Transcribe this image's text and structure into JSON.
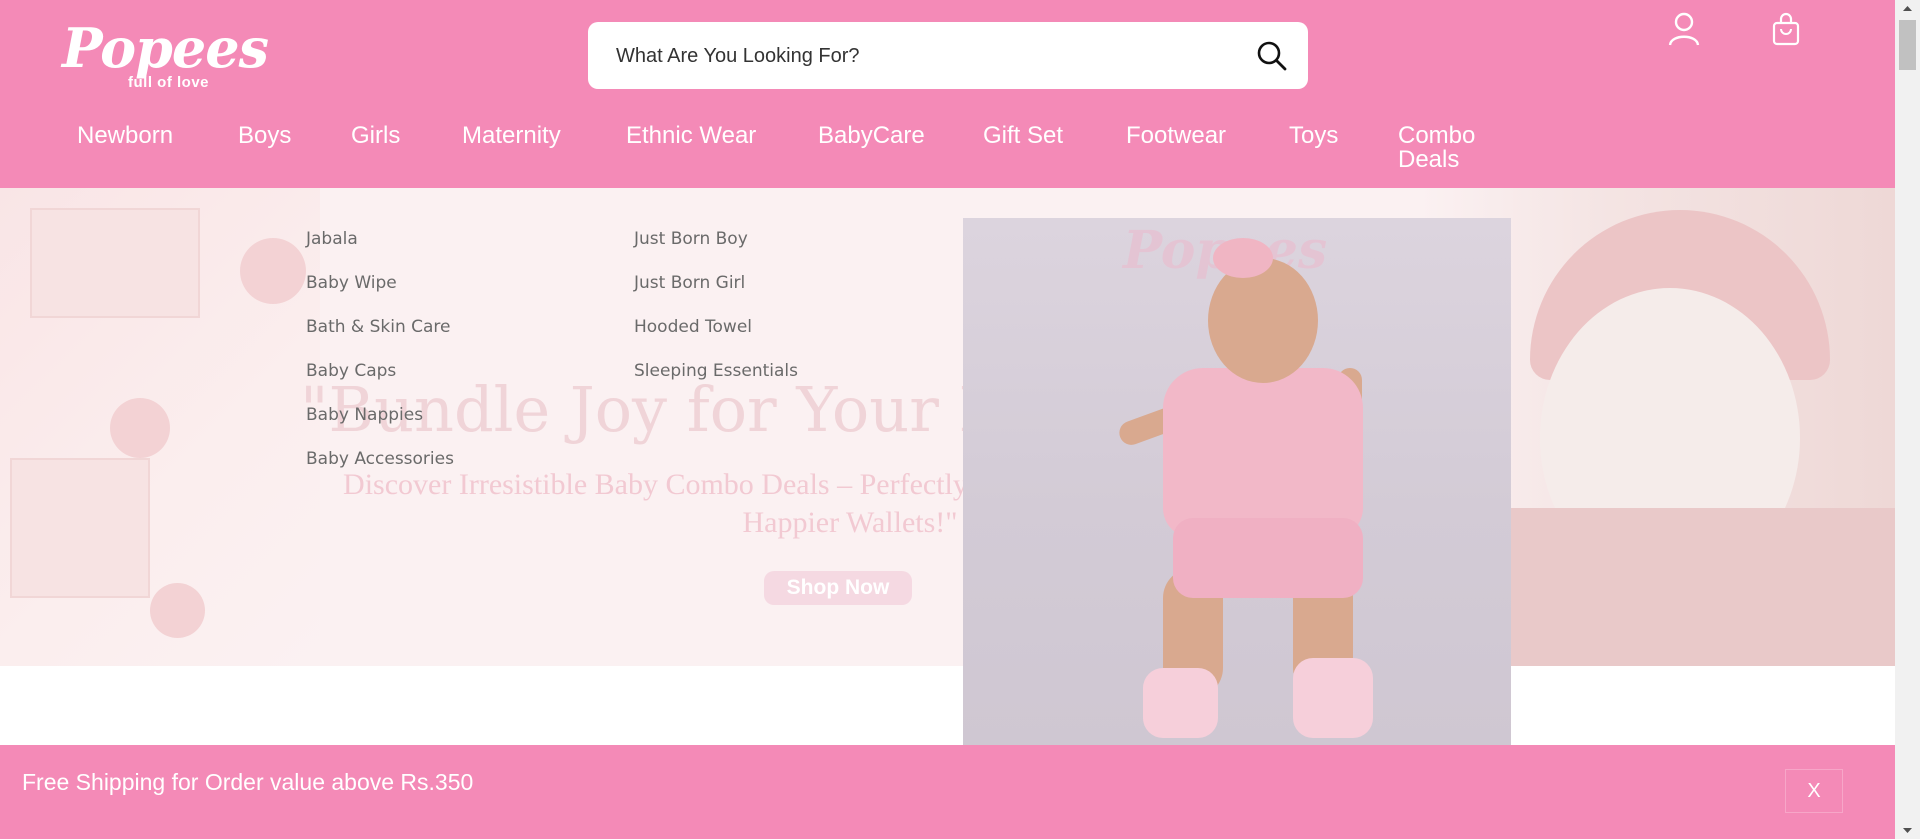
{
  "header": {
    "logo_text": "Popees",
    "logo_tagline": "full of love",
    "search_placeholder": "What Are You Looking For?",
    "icons": {
      "search": "search-icon",
      "account": "user-icon",
      "cart": "shopping-bag-icon"
    },
    "background_color": "#f48ab7"
  },
  "nav": {
    "items": [
      {
        "label": "Newborn"
      },
      {
        "label": "Boys"
      },
      {
        "label": "Girls"
      },
      {
        "label": "Maternity"
      },
      {
        "label": "Ethnic Wear"
      },
      {
        "label": "BabyCare"
      },
      {
        "label": "Gift Set"
      },
      {
        "label": "Footwear"
      },
      {
        "label": "Toys"
      },
      {
        "label": "Combo Deals"
      }
    ]
  },
  "mega_menu": {
    "column1": [
      "Jabala",
      "Baby Wipe",
      "Bath & Skin Care",
      "Baby Caps",
      "Baby Nappies",
      "Baby Accessories"
    ],
    "column2": [
      "Just Born Boy",
      "Just Born Girl",
      "Hooded Towel",
      "Sleeping Essentials"
    ],
    "image_logo_text": "Popees"
  },
  "hero": {
    "title": "\"Bundle Joy for Your Bundle of Joy!\"",
    "subtitle": "Discover Irresistible Baby Combo Deals – Perfectly Curated for Happier Babies and Happier Wallets!\"",
    "button_label": "Shop Now"
  },
  "shipping_bar": {
    "text": "Free Shipping for Order value above Rs.350",
    "close_label": "X"
  }
}
